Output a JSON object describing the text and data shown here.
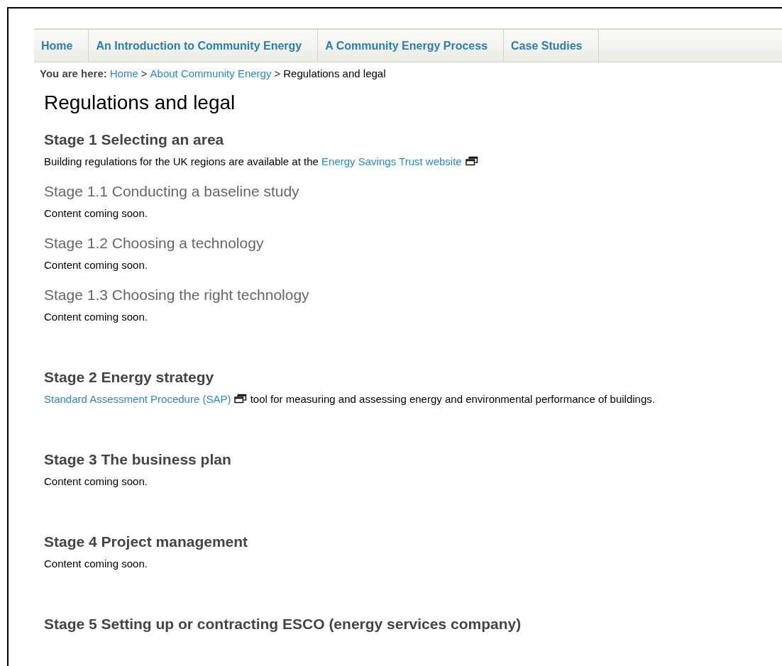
{
  "nav": {
    "tabs": [
      {
        "label": "Home"
      },
      {
        "label": "An Introduction to Community Energy"
      },
      {
        "label": "A Community Energy Process"
      },
      {
        "label": "Case Studies"
      }
    ]
  },
  "breadcrumb": {
    "prefix": "You are here:",
    "items": [
      {
        "label": "Home",
        "kind": "link"
      },
      {
        "label": "About Community Energy",
        "kind": "link"
      },
      {
        "label": "Regulations and legal",
        "kind": "current"
      }
    ],
    "separator": ">"
  },
  "title": "Regulations and legal",
  "stages": [
    {
      "title": "Stage 1 Selecting an area",
      "body": [
        {
          "kind": "text",
          "text": "Building regulations for the UK regions are available at the "
        },
        {
          "kind": "link",
          "text": "Energy Savings Trust website",
          "external": true
        }
      ],
      "substages": [
        {
          "title": "Stage 1.1 Conducting a baseline study",
          "body": [
            {
              "kind": "text",
              "text": "Content coming soon."
            }
          ]
        },
        {
          "title": "Stage 1.2 Choosing a technology",
          "body": [
            {
              "kind": "text",
              "text": "Content coming soon."
            }
          ]
        },
        {
          "title": "Stage 1.3 Choosing the right technology",
          "body": [
            {
              "kind": "text",
              "text": "Content coming soon."
            }
          ]
        }
      ]
    },
    {
      "title": "Stage 2 Energy strategy",
      "body": [
        {
          "kind": "link",
          "text": "Standard Assessment Procedure (SAP)",
          "external": true
        },
        {
          "kind": "text",
          "text": " tool for measuring and assessing energy and environmental performance of buildings."
        }
      ]
    },
    {
      "title": "Stage 3 The business plan",
      "body": [
        {
          "kind": "text",
          "text": "Content coming soon."
        }
      ]
    },
    {
      "title": "Stage 4 Project management",
      "body": [
        {
          "kind": "text",
          "text": "Content coming soon."
        }
      ]
    },
    {
      "title": "Stage 5 Setting up or contracting ESCO (energy services company)"
    }
  ]
}
